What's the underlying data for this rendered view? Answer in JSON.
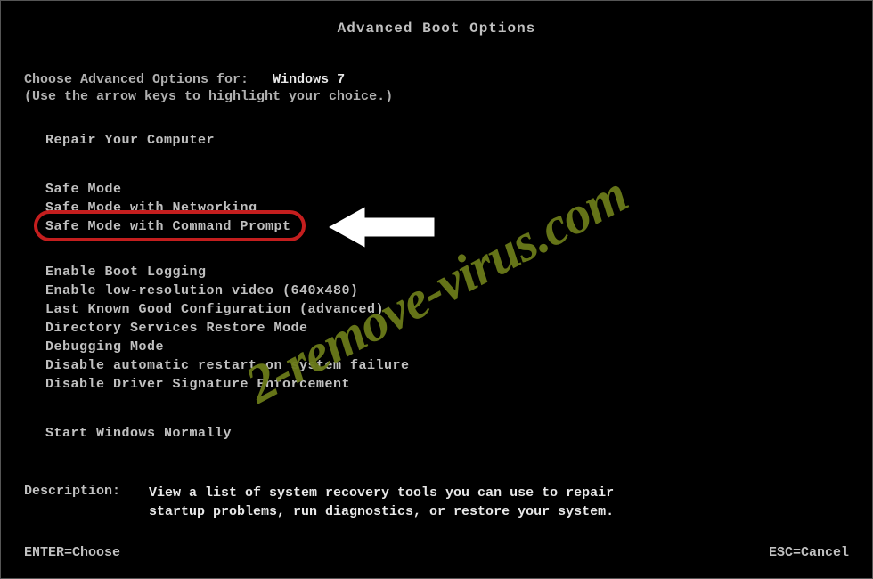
{
  "title": "Advanced Boot Options",
  "prompt": {
    "prefix": "Choose Advanced Options for:",
    "os": "Windows 7",
    "hint": "(Use the arrow keys to highlight your choice.)"
  },
  "groups": {
    "repair": {
      "label": "Repair Your Computer"
    },
    "safe": {
      "items": [
        "Safe Mode",
        "Safe Mode with Networking",
        "Safe Mode with Command Prompt"
      ],
      "highlighted_index": 2
    },
    "advanced": {
      "items": [
        "Enable Boot Logging",
        "Enable low-resolution video (640x480)",
        "Last Known Good Configuration (advanced)",
        "Directory Services Restore Mode",
        "Debugging Mode",
        "Disable automatic restart on system failure",
        "Disable Driver Signature Enforcement"
      ]
    },
    "normal": {
      "label": "Start Windows Normally"
    }
  },
  "description": {
    "label": "Description:",
    "text_line1": "View a list of system recovery tools you can use to repair",
    "text_line2": "startup problems, run diagnostics, or restore your system."
  },
  "footer": {
    "left": "ENTER=Choose",
    "right": "ESC=Cancel"
  },
  "watermark": "2-remove-virus.com",
  "colors": {
    "highlight_ring": "#C41E1E",
    "watermark": "#6B7B1A"
  }
}
